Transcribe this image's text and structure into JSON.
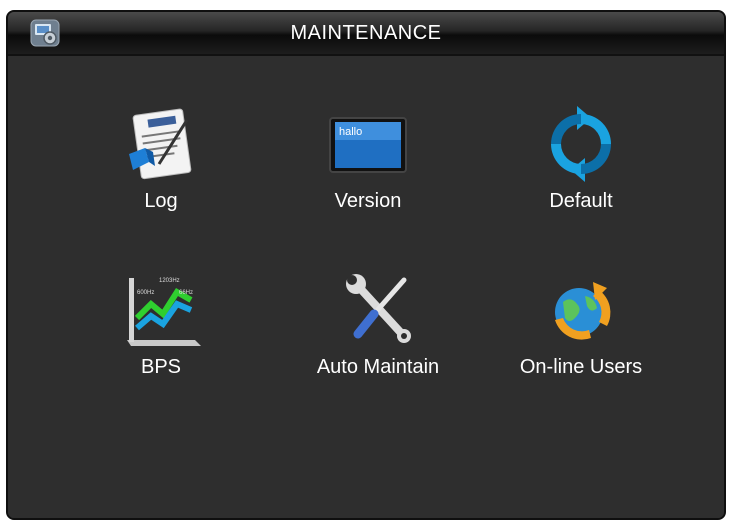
{
  "window": {
    "title": "MAINTENANCE",
    "title_icon": "settings-monitor-icon"
  },
  "items": [
    {
      "label": "Log",
      "icon": "log-document-icon"
    },
    {
      "label": "Version",
      "icon": "version-screen-icon",
      "icon_text": "hallo"
    },
    {
      "label": "Default",
      "icon": "refresh-icon"
    },
    {
      "label": "BPS",
      "icon": "bps-chart-icon",
      "icon_text": [
        "1203Hz",
        "600Hz",
        "66Hz"
      ]
    },
    {
      "label": "Auto Maintain",
      "icon": "tools-icon"
    },
    {
      "label": "On-line Users",
      "icon": "globe-refresh-icon"
    }
  ],
  "colors": {
    "background": "#2e2e2e",
    "title_text": "#ffffff",
    "label_text": "#ffffff",
    "accent_blue": "#1aa3e0",
    "accent_green": "#2fcf2f"
  }
}
